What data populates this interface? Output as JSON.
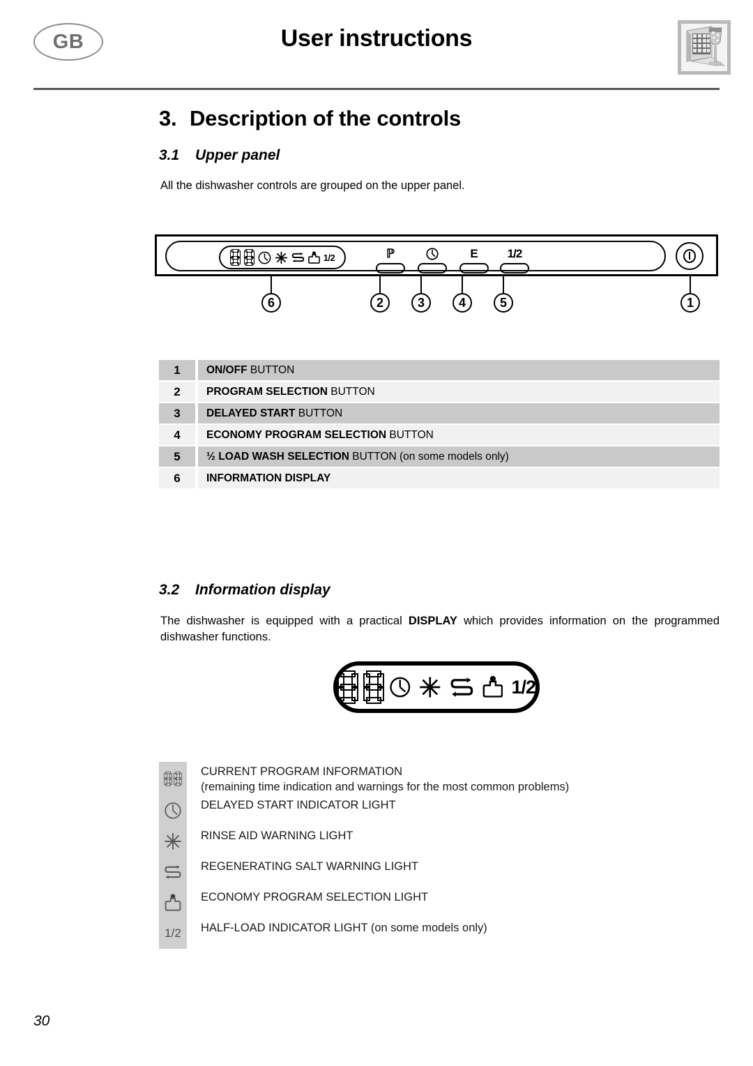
{
  "header": {
    "locale_badge": "GB",
    "title": "User instructions",
    "thumbnail_icon": "dishwasher-glass-thumbnail"
  },
  "chapter": {
    "number": "3.",
    "title": "Description of the controls"
  },
  "section_31": {
    "number": "3.1",
    "title": "Upper panel",
    "intro": "All the dishwasher controls are grouped on the upper panel."
  },
  "panel_diagram": {
    "display_icons": [
      "seven-segment-digit",
      "seven-segment-digit",
      "clock-icon",
      "rinse-aid-icon",
      "salt-icon",
      "economy-icon",
      "half-load-label"
    ],
    "half_load_label": "1/2",
    "buttons": [
      {
        "label": "P",
        "callout": "2",
        "name": "program-selection-button"
      },
      {
        "label": "clock-icon",
        "callout": "3",
        "name": "delayed-start-button"
      },
      {
        "label": "E",
        "callout": "4",
        "name": "economy-program-button"
      },
      {
        "label": "1/2",
        "callout": "5",
        "name": "half-load-button"
      }
    ],
    "power_button_callout": "1",
    "display_callout": "6"
  },
  "controls_table": {
    "rows": [
      {
        "num": "1",
        "bold": "ON/OFF",
        "rest": " BUTTON"
      },
      {
        "num": "2",
        "bold": "PROGRAM SELECTION",
        "rest": " BUTTON"
      },
      {
        "num": "3",
        "bold": "DELAYED START",
        "rest": " BUTTON"
      },
      {
        "num": "4",
        "bold": "ECONOMY PROGRAM SELECTION",
        "rest": " BUTTON"
      },
      {
        "num": "5",
        "bold": "½ LOAD WASH SELECTION",
        "rest": " BUTTON (on some models only)"
      },
      {
        "num": "6",
        "bold": "INFORMATION DISPLAY",
        "rest": ""
      }
    ]
  },
  "section_32": {
    "number": "3.2",
    "title": "Information display",
    "intro_before": "The dishwasher is equipped with a practical ",
    "intro_bold": "DISPLAY",
    "intro_after": " which provides information on the programmed dishwasher functions."
  },
  "big_display": {
    "half_load_label": "1/2"
  },
  "legend": {
    "items": [
      {
        "icon": "seven-segment-digits-icon",
        "label": "CURRENT PROGRAM INFORMATION",
        "sub": "(remaining time indication and warnings for the most common problems)"
      },
      {
        "icon": "clock-icon",
        "label": "DELAYED START INDICATOR LIGHT",
        "sub": ""
      },
      {
        "icon": "rinse-aid-icon",
        "label": "RINSE AID WARNING LIGHT",
        "sub": ""
      },
      {
        "icon": "salt-icon",
        "label": "REGENERATING SALT WARNING LIGHT",
        "sub": ""
      },
      {
        "icon": "economy-icon",
        "label": "ECONOMY PROGRAM SELECTION LIGHT",
        "sub": ""
      },
      {
        "icon": "half-load-icon",
        "label": "HALF-LOAD INDICATOR LIGHT (on some models only)",
        "sub": "",
        "icon_text": "1/2"
      }
    ]
  },
  "footer": {
    "page_number": "30"
  },
  "colors": {
    "table_row_dark": "#c9c9c9",
    "table_row_light": "#f1f1f1",
    "legend_box": "#cfcfcf",
    "rule": "#555555",
    "badge_gray": "#6f6f6f"
  }
}
